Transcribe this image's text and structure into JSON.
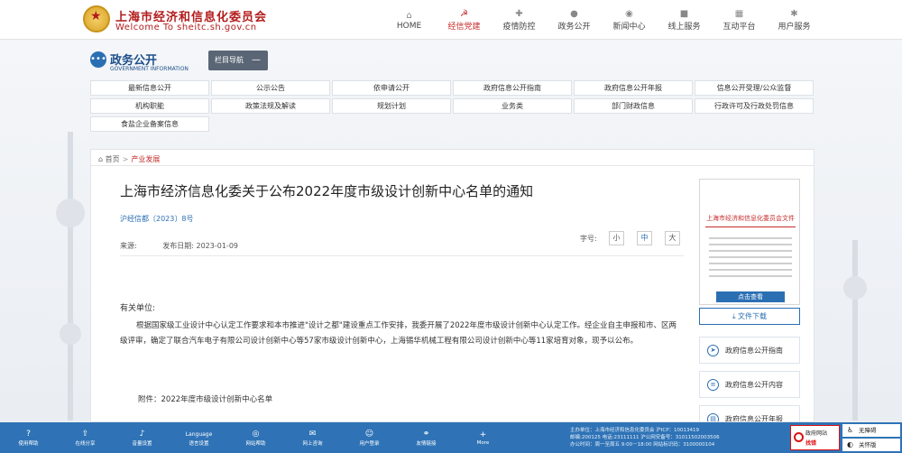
{
  "header": {
    "site_name": "上海市经济和信息化委员会",
    "site_en": "Welcome To sheitc.sh.gov.cn",
    "nav": [
      {
        "label": "HOME",
        "icon": "home-icon",
        "glyph": "⌂"
      },
      {
        "label": "经信党建",
        "icon": "party-emblem-icon",
        "glyph": "☭"
      },
      {
        "label": "疫情防控",
        "icon": "medical-kit-icon",
        "glyph": "✚"
      },
      {
        "label": "政务公开",
        "icon": "chat-bubble-icon",
        "glyph": "●"
      },
      {
        "label": "新闻中心",
        "icon": "globe-icon",
        "glyph": "◉"
      },
      {
        "label": "线上服务",
        "icon": "briefcase-icon",
        "glyph": "■"
      },
      {
        "label": "互动平台",
        "icon": "grid-icon",
        "glyph": "▦"
      },
      {
        "label": "用户服务",
        "icon": "user-icon",
        "glyph": "✱"
      }
    ],
    "active_color": "#c62c2c"
  },
  "gov_info": {
    "title": "政务公开",
    "subtitle": "GOVERNMENT INFORMATION",
    "nav_toggle_label": "栏目导航",
    "categories": [
      "最新信息公开",
      "公示公告",
      "依申请公开",
      "政府信息公开指南",
      "政府信息公开年报",
      "信息公开受理/公众监督",
      "机构职能",
      "政策法规及解读",
      "规划计划",
      "业务类",
      "部门财政信息",
      "行政许可及行政处罚信息",
      "食盐企业备案信息"
    ]
  },
  "breadcrumb": {
    "home": "首页",
    "current": "产业发展"
  },
  "article": {
    "title": "上海市经济信息化委关于公布2022年度市级设计创新中心名单的通知",
    "doc_number": "沪经信都〔2023〕8号",
    "source_label": "来源:",
    "date_label": "发布日期:",
    "date": "2023-01-09",
    "font_size_label": "字号:",
    "font_sizes": [
      "小",
      "中",
      "大"
    ],
    "salutation": "有关单位:",
    "body": "根据国家级工业设计中心认定工作要求和本市推进\"设计之都\"建设重点工作安排，我委开展了2022年度市级设计创新中心认定工作。经企业自主申报和市、区两级评审，确定了联合汽车电子有限公司设计创新中心等57家市级设计创新中心，上海锡华机械工程有限公司设计创新中心等11家培育对象，现予以公布。",
    "attachment": "附件：2022年度市级设计创新中心名单"
  },
  "sidebar": {
    "doc_header": "上海市经济和信息化委员会文件",
    "view_label": "点击查看",
    "download_label": "文件下载",
    "links": [
      {
        "label": "政府信息公开指南",
        "icon": "compass-icon",
        "glyph": "➤"
      },
      {
        "label": "政府信息公开内容",
        "icon": "list-icon",
        "glyph": "≡"
      },
      {
        "label": "政府信息公开年报",
        "icon": "report-icon",
        "glyph": "▤"
      }
    ]
  },
  "footer": {
    "tools": [
      {
        "label": "使用帮助",
        "icon": "help-icon",
        "glyph": "?"
      },
      {
        "label": "在线分享",
        "icon": "share-icon",
        "glyph": "⇪"
      },
      {
        "label": "音量设置",
        "icon": "volume-icon",
        "glyph": "♪"
      },
      {
        "label": "语言设置",
        "icon": "language-icon",
        "glyph": "Language"
      },
      {
        "label": "网站帮助",
        "icon": "site-help-icon",
        "glyph": "◎"
      },
      {
        "label": "网上咨询",
        "icon": "consult-icon",
        "glyph": "✉"
      },
      {
        "label": "用户登录",
        "icon": "login-icon",
        "glyph": "☺"
      },
      {
        "label": "友情链接",
        "icon": "link-icon",
        "glyph": "⚭"
      },
      {
        "label": "More",
        "icon": "more-icon",
        "glyph": "+"
      }
    ],
    "info_lines": [
      "主办单位：上海市经济和信息化委员会   沪ICP：10013419",
      "邮编:200125 电话:23111111   沪公网安备号：31011502003506",
      "办公时间：周一至周五 9:00－18:00   网站标识码：3100000104"
    ],
    "gov_error_top": "政府网站",
    "gov_error_bottom": "找错",
    "accessibility": [
      {
        "label": "无障碍",
        "icon": "accessibility-icon",
        "glyph": "♿"
      },
      {
        "label": "关怀版",
        "icon": "care-mode-icon",
        "glyph": "◐"
      }
    ]
  }
}
